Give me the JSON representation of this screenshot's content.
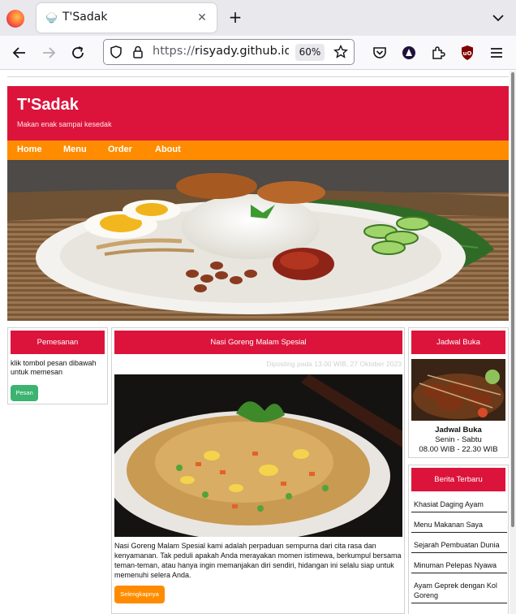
{
  "browser": {
    "tab_title": "T'Sadak",
    "url_protocol": "https://",
    "url_host": "risyady.github.io",
    "zoom": "60%"
  },
  "site": {
    "title": "T'Sadak",
    "tagline": "Makan enak sampai kesedak",
    "nav": [
      "Home",
      "Menu",
      "Order",
      "About"
    ]
  },
  "left_box": {
    "heading": "Pemesanan",
    "text": "klik tombol pesan dibawah untuk memesan",
    "button": "Pesan"
  },
  "main": {
    "heading": "Nasi Goreng Malam Spesial",
    "meta": "Diposting pada 13.00 WIB, 27 Oktober 2023",
    "body": "Nasi Goreng Malam Spesial kami adalah perpaduan sempurna dari cita rasa dan kenyamanan. Tak peduli apakah Anda merayakan momen istimewa, berkumpul bersama teman-teman, atau hanya ingin memanjakan diri sendiri, hidangan ini selalu siap untuk memenuhi selera Anda.",
    "button": "Selengkapnya"
  },
  "schedule": {
    "heading": "Jadwal Buka",
    "title": "Jadwal Buka",
    "days": "Senin - Sabtu",
    "hours": "08.00 WIB - 22.30 WIB"
  },
  "news": {
    "heading": "Berita Terbaru",
    "items": [
      "Khasiat Daging Ayam",
      "Menu Makanan Saya",
      "Sejarah Pembuatan Dunia",
      "Minuman Pelepas Nyawa",
      "Ayam Geprek dengan Kol Goreng"
    ]
  },
  "colors": {
    "primary": "#dc143c",
    "nav": "#ff8c00",
    "order_button": "#3cb371"
  }
}
